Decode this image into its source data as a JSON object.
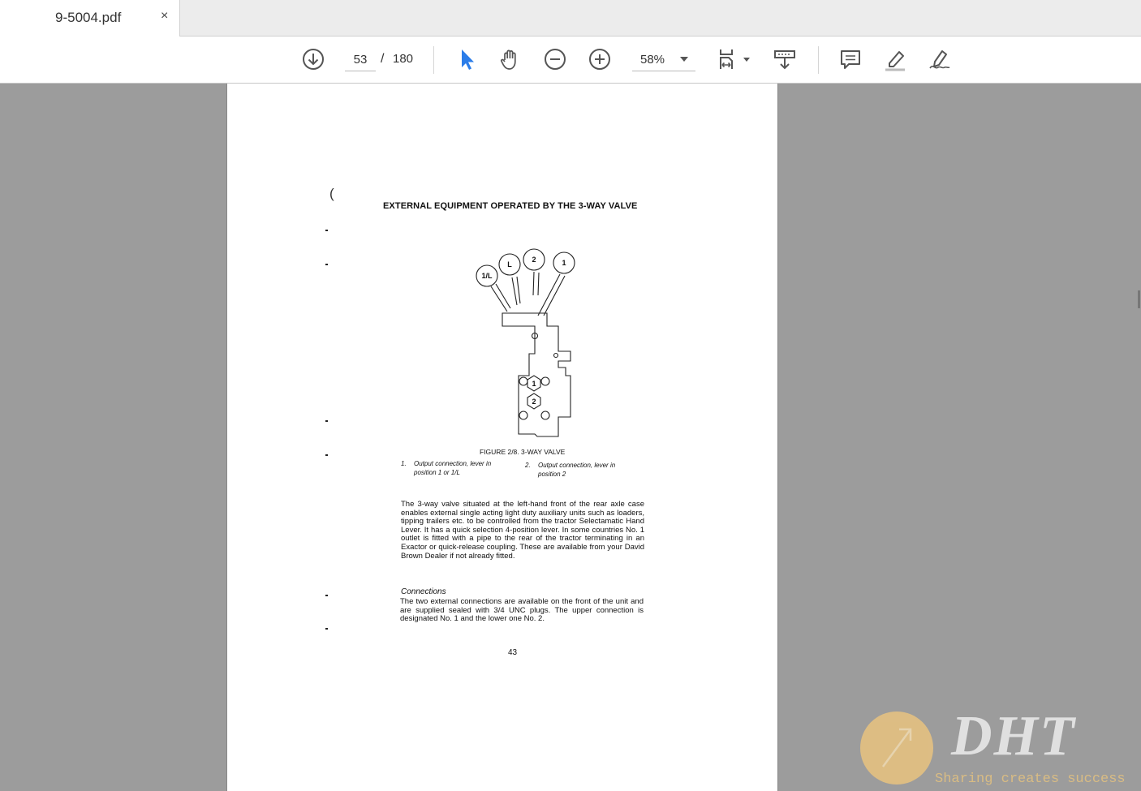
{
  "tab": {
    "title": "9-5004.pdf",
    "close_glyph": "×"
  },
  "toolbar": {
    "page_current": "53",
    "page_separator": "/",
    "page_total": "180",
    "zoom": "58%",
    "icons": [
      "download-icon",
      "select-cursor-icon",
      "hand-pan-icon",
      "zoom-out-icon",
      "zoom-in-icon",
      "fit-page-icon",
      "scroll-mode-icon",
      "comment-icon",
      "highlight-icon",
      "sign-icon"
    ],
    "accent_color": "#2b7de9"
  },
  "document": {
    "heading": "EXTERNAL EQUIPMENT OPERATED BY THE 3-WAY VALVE",
    "figure": {
      "lever_labels": [
        "1/L",
        "L",
        "2",
        "1"
      ],
      "port_labels": [
        "1",
        "2"
      ],
      "caption": "FIGURE 2/8. 3-WAY VALVE",
      "legend": [
        {
          "num": "1.",
          "text": "Output connection, lever in position 1 or 1/L"
        },
        {
          "num": "2.",
          "text": "Output connection, lever in position 2"
        }
      ]
    },
    "body": "The 3-way valve situated at the left-hand front of the rear axle case enables external single acting light duty auxiliary units such as loaders, tipping trailers etc. to be controlled from the tractor Selectamatic Hand Lever. It has a quick selection 4-position lever. In some countries No. 1 outlet is fitted with a pipe to the rear of the tractor terminating in an Exactor or quick-release coupling. These are available from your David Brown Dealer if not already fitted.",
    "connections_heading": "Connections",
    "connections_body": "The two external connections are available on the front of the unit and are supplied sealed with 3/4 UNC plugs. The upper connection is designated No. 1 and the lower one No. 2.",
    "page_number": "43"
  },
  "watermark": {
    "logo": "DHT",
    "slogan": "Sharing creates success"
  }
}
